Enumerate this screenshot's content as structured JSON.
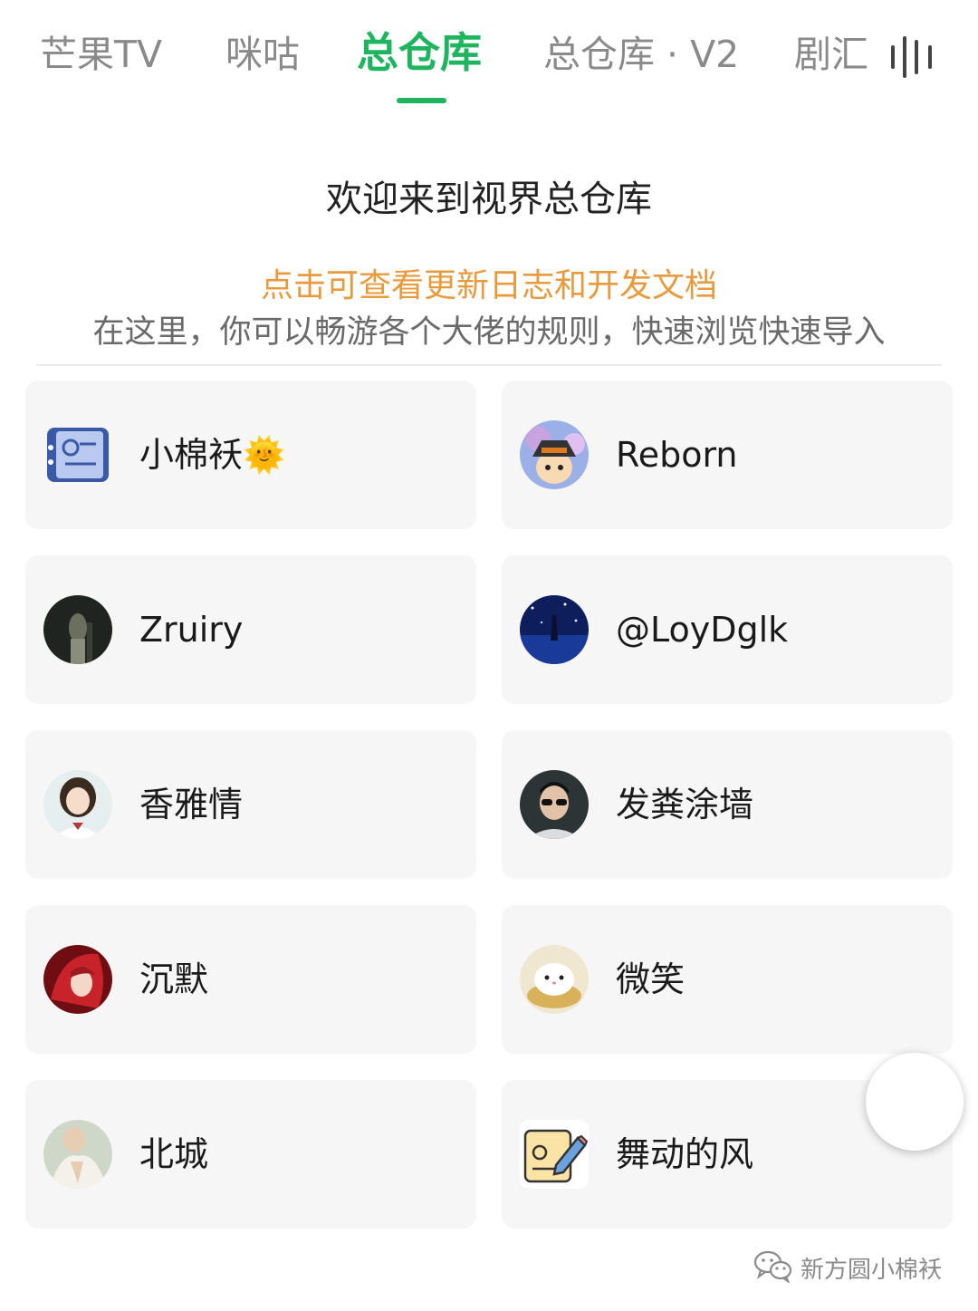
{
  "tabs": [
    {
      "label": "芒果TV",
      "active": false
    },
    {
      "label": "咪咕",
      "active": false
    },
    {
      "label": "总仓库",
      "active": true
    },
    {
      "label": "总仓库 · V2",
      "active": false
    },
    {
      "label": "剧汇",
      "active": false
    }
  ],
  "menu_icon": "vertical-bars-menu-icon",
  "header": {
    "welcome": "欢迎来到视界总仓库",
    "changelog_link": "点击可查看更新日志和开发文档",
    "description": "在这里，你可以畅游各个大佬的规则，快速浏览快速导入"
  },
  "authors": [
    {
      "name": "小棉袄🌞",
      "avatar": "app-icon-avatar"
    },
    {
      "name": "Reborn",
      "avatar": "cartoon-avatar"
    },
    {
      "name": "Zruiry",
      "avatar": "dark-photo-avatar"
    },
    {
      "name": "@LoyDglk",
      "avatar": "night-sky-avatar"
    },
    {
      "name": "香雅情",
      "avatar": "girl-photo-avatar"
    },
    {
      "name": "发粪涂墙",
      "avatar": "sunglasses-photo-avatar"
    },
    {
      "name": "沉默",
      "avatar": "red-anime-avatar"
    },
    {
      "name": "微笑",
      "avatar": "cat-in-cup-avatar"
    },
    {
      "name": "北城",
      "avatar": "portrait-photo-avatar"
    },
    {
      "name": "舞动的风",
      "avatar": "notepad-pencil-avatar"
    }
  ],
  "watermark": {
    "text": "新方圆小棉袄",
    "icon": "wechat-icon"
  },
  "colors": {
    "accent": "#1fb55f",
    "link": "#e89a3c",
    "card_bg": "#f6f6f6"
  }
}
